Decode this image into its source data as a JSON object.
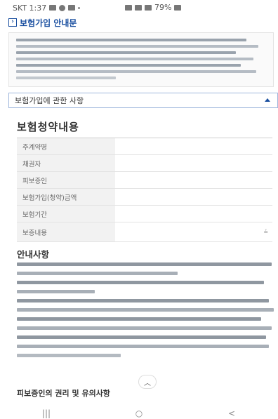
{
  "status_bar": {
    "carrier_time": "SKT 1:37",
    "battery": "79%"
  },
  "header": {
    "title": "보험가입 안내문"
  },
  "section_toggle": {
    "label": "보험가입에 관한 사항"
  },
  "contract_section": {
    "heading": "보험청약내용",
    "rows": [
      {
        "label": "주계약명"
      },
      {
        "label": "채권자"
      },
      {
        "label": "피보증인"
      },
      {
        "label": "보험가입(청약)금액"
      },
      {
        "label": "보험기간"
      },
      {
        "label": "보증내용"
      }
    ]
  },
  "notice_section": {
    "heading": "안내사항"
  },
  "rights_section": {
    "heading": "피보증인의 권리 및 유의사항"
  },
  "nav_bar": {
    "recent": "|||",
    "home": "○",
    "back": "<"
  }
}
